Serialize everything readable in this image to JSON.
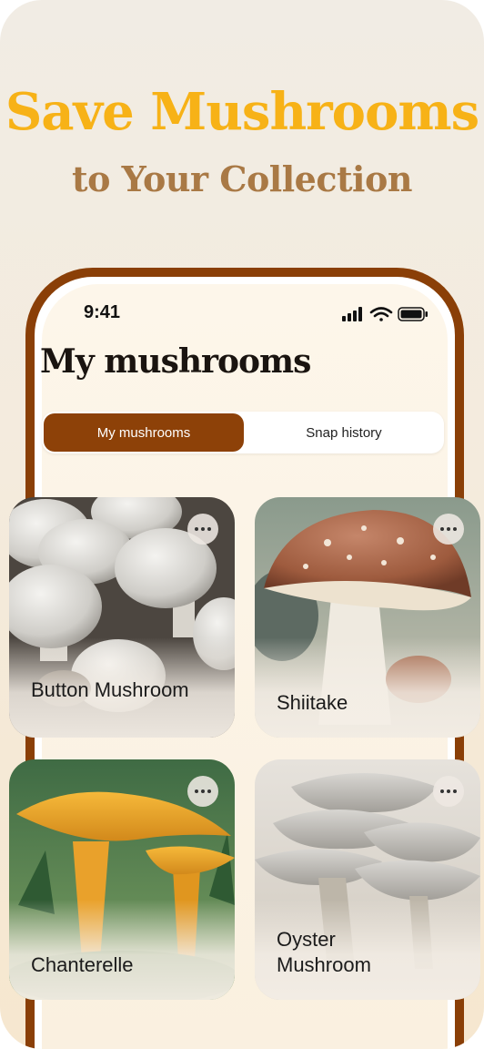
{
  "promo": {
    "headline": "Save Mushrooms",
    "subheadline": "to Your Collection"
  },
  "status_bar": {
    "time": "9:41",
    "icons": [
      "cellular-signal-icon",
      "wifi-icon",
      "battery-icon"
    ]
  },
  "screen": {
    "title": "My mushrooms",
    "segments": [
      {
        "label": "My mushrooms",
        "selected": true
      },
      {
        "label": "Snap history",
        "selected": false
      }
    ]
  },
  "cards": [
    {
      "name": "Button Mushroom"
    },
    {
      "name": "Shiitake"
    },
    {
      "name": "Chanterelle"
    },
    {
      "name": "Oyster Mushroom"
    }
  ],
  "colors": {
    "headline": "#f7b217",
    "subheadline": "#a97945",
    "frame": "#8a3f07",
    "active_segment": "#8d4108"
  }
}
